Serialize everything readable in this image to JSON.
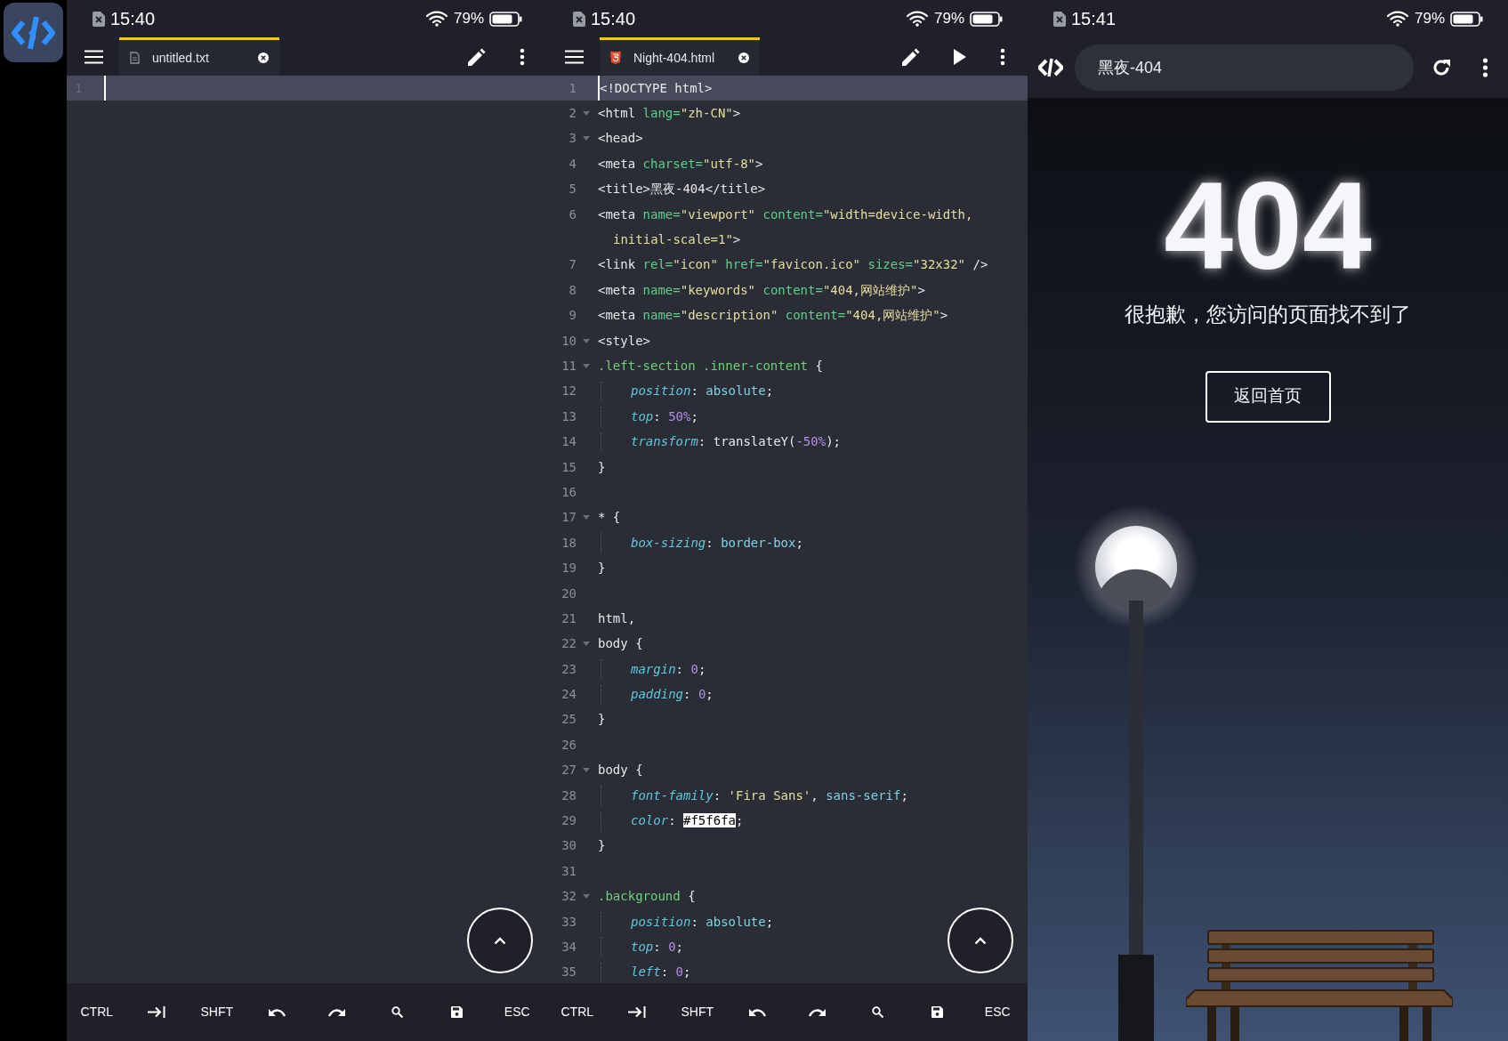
{
  "editors": [
    {
      "status_bar": {
        "time": "15:40",
        "battery": "79%"
      },
      "tab": {
        "label": "untitled.txt",
        "kind": "text",
        "selected": true
      },
      "actions": [
        {
          "kind": "edit"
        },
        {
          "kind": "more"
        }
      ],
      "lines": [
        {
          "number": "1",
          "current": true
        }
      ],
      "key_bar": [
        {
          "kind": "text",
          "label": "CTRL"
        },
        {
          "kind": "tab"
        },
        {
          "kind": "text",
          "label": "SHFT"
        },
        {
          "kind": "undo"
        },
        {
          "kind": "redo"
        },
        {
          "kind": "search"
        },
        {
          "kind": "save"
        },
        {
          "kind": "text",
          "label": "ESC"
        }
      ]
    },
    {
      "status_bar": {
        "time": "15:40",
        "battery": "79%"
      },
      "tab": {
        "label": "Night-404.html",
        "kind": "html",
        "selected": true
      },
      "actions": [
        {
          "kind": "edit"
        },
        {
          "kind": "run"
        },
        {
          "kind": "more"
        }
      ],
      "lines": [
        {
          "number": "1",
          "current": true,
          "tokens": [
            {
              "text": "<!DOCTYPE html>",
              "kind": "plain"
            }
          ]
        },
        {
          "number": "2",
          "fold": true,
          "tokens": [
            {
              "text": "<html ",
              "kind": "plain"
            },
            {
              "text": "lang=",
              "kind": "attr"
            },
            {
              "text": "\"zh-CN\"",
              "kind": "string"
            },
            {
              "text": ">",
              "kind": "plain"
            }
          ]
        },
        {
          "number": "3",
          "fold": true,
          "tokens": [
            {
              "text": "<head>",
              "kind": "plain"
            }
          ]
        },
        {
          "number": "4",
          "tokens": [
            {
              "text": "<meta ",
              "kind": "plain"
            },
            {
              "text": "charset=",
              "kind": "attr"
            },
            {
              "text": "\"utf-8\"",
              "kind": "string"
            },
            {
              "text": ">",
              "kind": "plain"
            }
          ]
        },
        {
          "number": "5",
          "tokens": [
            {
              "text": "<title>黑夜-404</title>",
              "kind": "plain"
            }
          ]
        },
        {
          "number": "6",
          "tokens": [
            {
              "text": "<meta ",
              "kind": "plain"
            },
            {
              "text": "name=",
              "kind": "attr"
            },
            {
              "text": "\"viewport\"",
              "kind": "string"
            },
            {
              "text": " content=",
              "kind": "attr"
            },
            {
              "text": "\"width=device-width,",
              "kind": "string"
            }
          ],
          "continuation": [
            {
              "text": "initial-scale=1\"",
              "kind": "string"
            },
            {
              "text": ">",
              "kind": "plain"
            }
          ]
        },
        {
          "number": "7",
          "tokens": [
            {
              "text": "<link ",
              "kind": "plain"
            },
            {
              "text": "rel=",
              "kind": "attr"
            },
            {
              "text": "\"icon\"",
              "kind": "string"
            },
            {
              "text": " href=",
              "kind": "attr"
            },
            {
              "text": "\"favicon.ico\"",
              "kind": "string"
            },
            {
              "text": " sizes=",
              "kind": "attr"
            },
            {
              "text": "\"32x32\"",
              "kind": "string"
            },
            {
              "text": " />",
              "kind": "plain"
            }
          ]
        },
        {
          "number": "8",
          "tokens": [
            {
              "text": "<meta ",
              "kind": "plain"
            },
            {
              "text": "name=",
              "kind": "attr"
            },
            {
              "text": "\"keywords\"",
              "kind": "string"
            },
            {
              "text": " content=",
              "kind": "attr"
            },
            {
              "text": "\"404,网站维护\"",
              "kind": "string"
            },
            {
              "text": ">",
              "kind": "plain"
            }
          ]
        },
        {
          "number": "9",
          "tokens": [
            {
              "text": "<meta ",
              "kind": "plain"
            },
            {
              "text": "name=",
              "kind": "attr"
            },
            {
              "text": "\"description\"",
              "kind": "string"
            },
            {
              "text": " content=",
              "kind": "attr"
            },
            {
              "text": "\"404,网站维护\"",
              "kind": "string"
            },
            {
              "text": ">",
              "kind": "plain"
            }
          ]
        },
        {
          "number": "10",
          "fold": true,
          "tokens": [
            {
              "text": "<style>",
              "kind": "plain"
            }
          ]
        },
        {
          "number": "11",
          "fold": true,
          "tokens": [
            {
              "text": ".left-section .inner-content",
              "kind": "selector"
            },
            {
              "text": " {",
              "kind": "plain"
            }
          ]
        },
        {
          "number": "12",
          "indented": true,
          "tokens": [
            {
              "text": "position",
              "kind": "prop"
            },
            {
              "text": ": ",
              "kind": "plain"
            },
            {
              "text": "absolute",
              "kind": "value"
            },
            {
              "text": ";",
              "kind": "plain"
            }
          ]
        },
        {
          "number": "13",
          "indented": true,
          "tokens": [
            {
              "text": "top",
              "kind": "prop"
            },
            {
              "text": ": ",
              "kind": "plain"
            },
            {
              "text": "50%",
              "kind": "number"
            },
            {
              "text": ";",
              "kind": "plain"
            }
          ]
        },
        {
          "number": "14",
          "indented": true,
          "tokens": [
            {
              "text": "transform",
              "kind": "prop"
            },
            {
              "text": ": ",
              "kind": "plain"
            },
            {
              "text": "translateY(",
              "kind": "plain"
            },
            {
              "text": "-50%",
              "kind": "number"
            },
            {
              "text": ");",
              "kind": "plain"
            }
          ]
        },
        {
          "number": "15",
          "tokens": [
            {
              "text": "}",
              "kind": "plain"
            }
          ]
        },
        {
          "number": "16"
        },
        {
          "number": "17",
          "fold": true,
          "tokens": [
            {
              "text": "* {",
              "kind": "plain"
            }
          ]
        },
        {
          "number": "18",
          "indented": true,
          "tokens": [
            {
              "text": "box-sizing",
              "kind": "prop"
            },
            {
              "text": ": ",
              "kind": "plain"
            },
            {
              "text": "border-box",
              "kind": "value"
            },
            {
              "text": ";",
              "kind": "plain"
            }
          ]
        },
        {
          "number": "19",
          "tokens": [
            {
              "text": "}",
              "kind": "plain"
            }
          ]
        },
        {
          "number": "20"
        },
        {
          "number": "21",
          "tokens": [
            {
              "text": "html,",
              "kind": "plain"
            }
          ]
        },
        {
          "number": "22",
          "fold": true,
          "tokens": [
            {
              "text": "body {",
              "kind": "plain"
            }
          ]
        },
        {
          "number": "23",
          "indented": true,
          "tokens": [
            {
              "text": "margin",
              "kind": "prop"
            },
            {
              "text": ": ",
              "kind": "plain"
            },
            {
              "text": "0",
              "kind": "number"
            },
            {
              "text": ";",
              "kind": "plain"
            }
          ]
        },
        {
          "number": "24",
          "indented": true,
          "tokens": [
            {
              "text": "padding",
              "kind": "prop"
            },
            {
              "text": ": ",
              "kind": "plain"
            },
            {
              "text": "0",
              "kind": "number"
            },
            {
              "text": ";",
              "kind": "plain"
            }
          ]
        },
        {
          "number": "25",
          "tokens": [
            {
              "text": "}",
              "kind": "plain"
            }
          ]
        },
        {
          "number": "26"
        },
        {
          "number": "27",
          "fold": true,
          "tokens": [
            {
              "text": "body {",
              "kind": "plain"
            }
          ]
        },
        {
          "number": "28",
          "indented": true,
          "tokens": [
            {
              "text": "font-family",
              "kind": "prop"
            },
            {
              "text": ": ",
              "kind": "plain"
            },
            {
              "text": "'Fira Sans'",
              "kind": "string"
            },
            {
              "text": ", ",
              "kind": "plain"
            },
            {
              "text": "sans-serif",
              "kind": "value"
            },
            {
              "text": ";",
              "kind": "plain"
            }
          ]
        },
        {
          "number": "29",
          "indented": true,
          "tokens": [
            {
              "text": "color",
              "kind": "prop"
            },
            {
              "text": ": ",
              "kind": "plain"
            },
            {
              "text": "#f5f6fa",
              "kind": "selection"
            },
            {
              "text": ";",
              "kind": "plain"
            }
          ]
        },
        {
          "number": "30",
          "tokens": [
            {
              "text": "}",
              "kind": "plain"
            }
          ]
        },
        {
          "number": "31"
        },
        {
          "number": "32",
          "fold": true,
          "tokens": [
            {
              "text": ".background",
              "kind": "selector"
            },
            {
              "text": " {",
              "kind": "plain"
            }
          ]
        },
        {
          "number": "33",
          "indented": true,
          "tokens": [
            {
              "text": "position",
              "kind": "prop"
            },
            {
              "text": ": ",
              "kind": "plain"
            },
            {
              "text": "absolute",
              "kind": "value"
            },
            {
              "text": ";",
              "kind": "plain"
            }
          ]
        },
        {
          "number": "34",
          "indented": true,
          "tokens": [
            {
              "text": "top",
              "kind": "prop"
            },
            {
              "text": ": ",
              "kind": "plain"
            },
            {
              "text": "0",
              "kind": "number"
            },
            {
              "text": ";",
              "kind": "plain"
            }
          ]
        },
        {
          "number": "35",
          "indented": true,
          "tokens": [
            {
              "text": "left",
              "kind": "prop"
            },
            {
              "text": ": ",
              "kind": "plain"
            },
            {
              "text": "0",
              "kind": "number"
            },
            {
              "text": ";",
              "kind": "plain"
            }
          ]
        }
      ],
      "key_bar": [
        {
          "kind": "text",
          "label": "CTRL"
        },
        {
          "kind": "tab"
        },
        {
          "kind": "text",
          "label": "SHFT"
        },
        {
          "kind": "undo"
        },
        {
          "kind": "redo"
        },
        {
          "kind": "search"
        },
        {
          "kind": "save"
        },
        {
          "kind": "text",
          "label": "ESC"
        }
      ]
    }
  ],
  "browser": {
    "status_bar": {
      "time": "15:41",
      "battery": "79%"
    },
    "address": "黑夜-404",
    "page": {
      "heading": "404",
      "message": "很抱歉，您访问的页面找不到了",
      "button": "返回首页"
    }
  }
}
